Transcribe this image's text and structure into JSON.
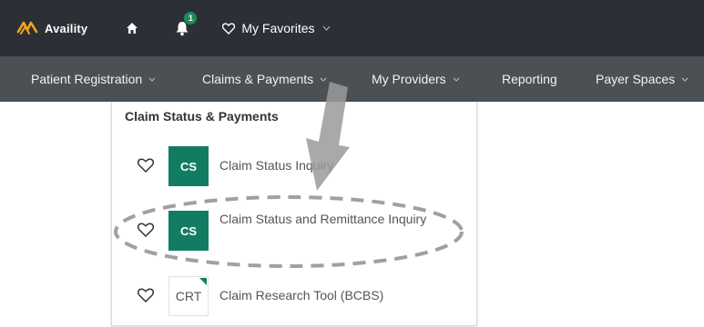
{
  "topbar": {
    "brand": "Availity",
    "notification_count": "1",
    "favorites_label": "My Favorites",
    "background": "#2c3036",
    "accent": "#f7a21b"
  },
  "navbar": {
    "items": [
      {
        "label": "Patient Registration"
      },
      {
        "label": "Claims & Payments"
      },
      {
        "label": "My Providers"
      },
      {
        "label": "Reporting"
      },
      {
        "label": "Payer Spaces"
      }
    ],
    "background": "#4b5055"
  },
  "dropdown": {
    "heading": "Claim Status & Payments",
    "items": [
      {
        "badge": "CS",
        "label": "Claim Status Inquiry",
        "badge_color": "#127c63",
        "icon": "heart-outline-icon"
      },
      {
        "badge": "CS",
        "label": "Claim Status and Remittance Inquiry",
        "badge_color": "#127c63",
        "icon": "heart-outline-icon"
      },
      {
        "badge": "CRT",
        "label": "Claim Research Tool (BCBS)",
        "badge_color": "#ffffff",
        "icon": "heart-outline-icon"
      }
    ]
  },
  "annotations": {
    "arrow_color": "#9a9a9a",
    "ellipse_color": "#a0a0a0"
  }
}
